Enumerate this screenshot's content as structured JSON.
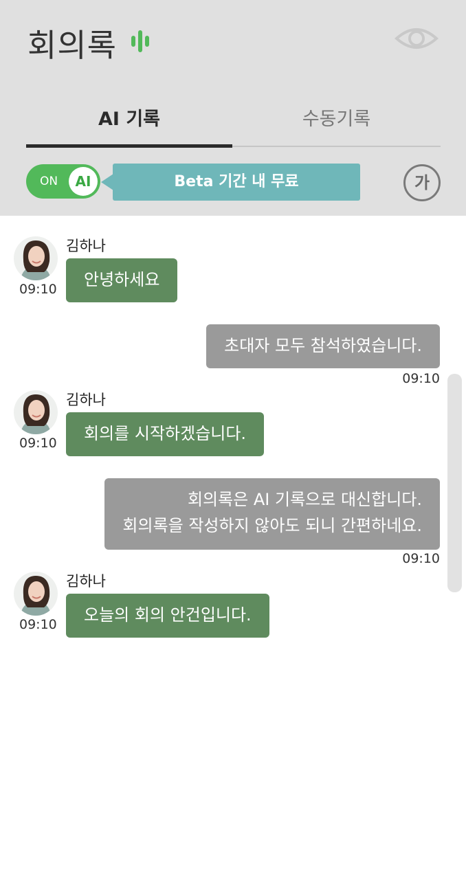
{
  "header": {
    "title": "회의록",
    "mic_icon": "mic-level-icon",
    "eye_icon": "eye-icon",
    "accent_color": "#52b95a"
  },
  "tabs": [
    {
      "label": "AI 기록",
      "active": true
    },
    {
      "label": "수동기록",
      "active": false
    }
  ],
  "toggle": {
    "state_label": "ON",
    "knob_label": "AI"
  },
  "banner": {
    "text": "Beta 기간 내 무료"
  },
  "font_button": {
    "label": "가"
  },
  "messages": [
    {
      "direction": "in",
      "sender": "김하나",
      "time": "09:10",
      "text": "안녕하세요"
    },
    {
      "direction": "out",
      "time": "09:10",
      "text": "초대자 모두 참석하였습니다."
    },
    {
      "direction": "in",
      "sender": "김하나",
      "time": "09:10",
      "text": "회의를 시작하겠습니다."
    },
    {
      "direction": "out",
      "time": "09:10",
      "lines": [
        "회의록은 AI 기록으로 대신합니다.",
        "회의록을 작성하지 않아도 되니 간편하네요."
      ]
    },
    {
      "direction": "in",
      "sender": "김하나",
      "time": "09:10",
      "text": "오늘의 회의 안건입니다."
    }
  ]
}
